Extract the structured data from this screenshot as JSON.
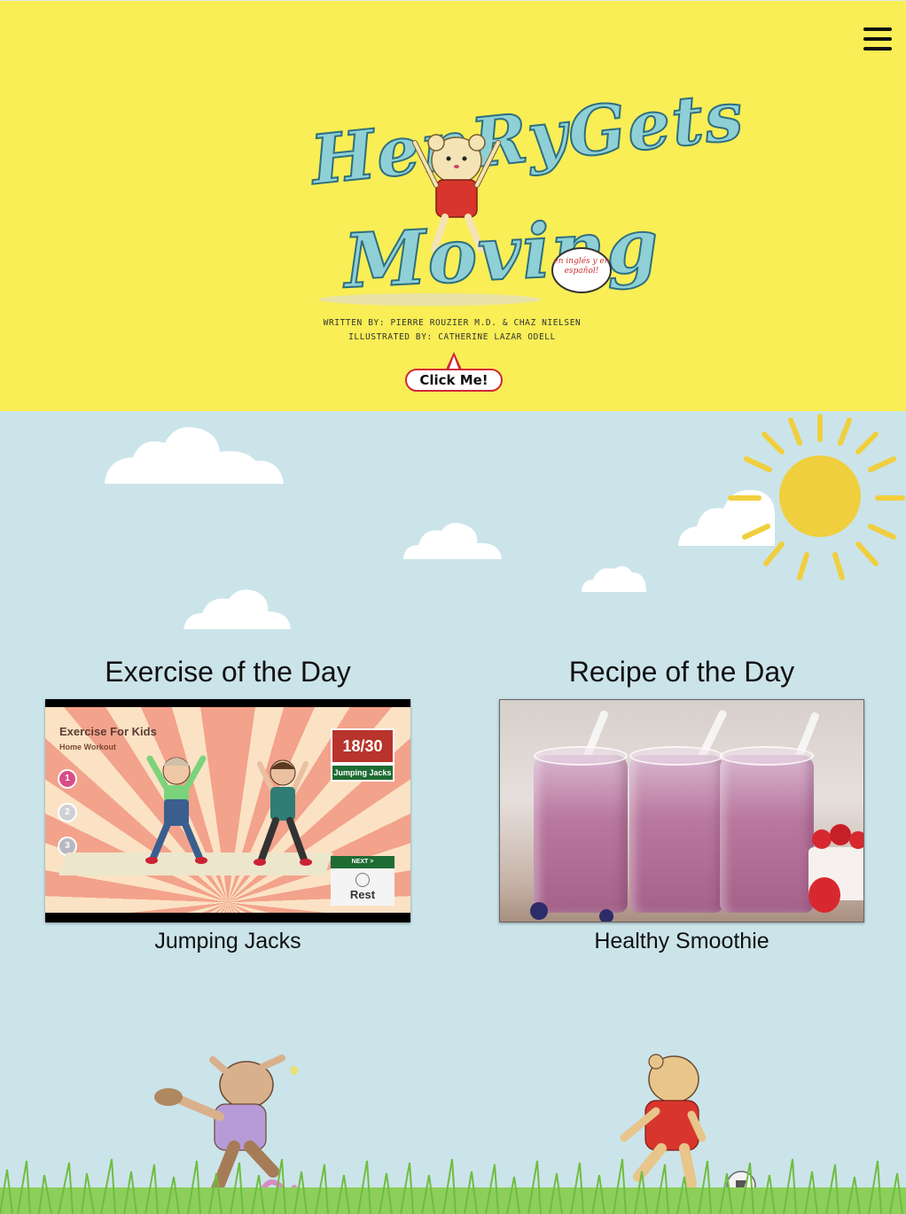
{
  "header": {
    "menu_icon": "hamburger-menu-icon",
    "logo": {
      "title_line1": "HenRyGets",
      "title_line2": "Moving",
      "bubble_text": "en inglés y en español!",
      "written_by": "WRITTEN BY: PIERRE ROUZIER M.D. & CHAZ NIELSEN",
      "illustrated_by": "ILLUSTRATED BY: CATHERINE LAZAR ODELL"
    },
    "click_me_label": "Click Me!",
    "background_color": "#f9ee55"
  },
  "sky": {
    "background_color": "#cbe4ea",
    "sun_color": "#f0cf3e"
  },
  "exercise": {
    "section_title": "Exercise of the Day",
    "caption": "Jumping Jacks",
    "thumbnail": {
      "title": "Exercise For Kids",
      "subtitle": "Home Workout",
      "counter": "18/30",
      "exercise_name": "Jumping Jacks",
      "next_label": "NEXT >",
      "rest_label": "Rest",
      "medals": [
        "1",
        "2",
        "3"
      ]
    }
  },
  "recipe": {
    "section_title": "Recipe of the Day",
    "caption": "Healthy Smoothie"
  }
}
